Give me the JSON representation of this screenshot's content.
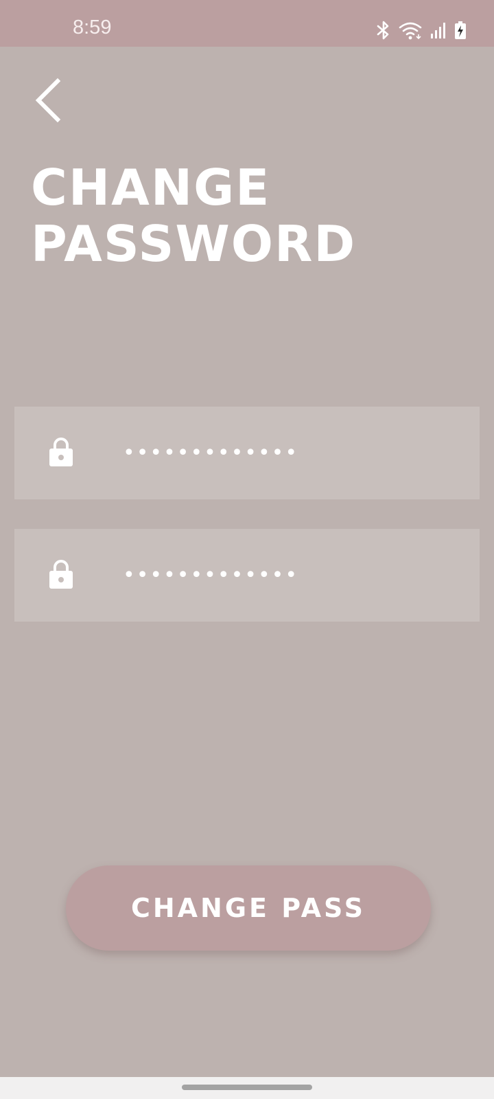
{
  "status_bar": {
    "time": "8:59",
    "icons": [
      "bluetooth-icon",
      "wifi-icon",
      "signal-icon",
      "battery-charging-icon"
    ]
  },
  "header": {
    "back_icon": "chevron-left-icon",
    "title": "CHANGE\nPASSWORD"
  },
  "form": {
    "fields": [
      {
        "icon": "lock-icon",
        "type": "password",
        "value": "•••••••••••••"
      },
      {
        "icon": "lock-icon",
        "type": "password",
        "value": "•••••••••••••"
      }
    ],
    "submit_label": "CHANGE PASS"
  },
  "colors": {
    "background": "#bdb2af",
    "status_bar": "#bb9fa0",
    "field_background": "#c8bfbc",
    "button": "#bb9fa0",
    "text": "#ffffff"
  }
}
